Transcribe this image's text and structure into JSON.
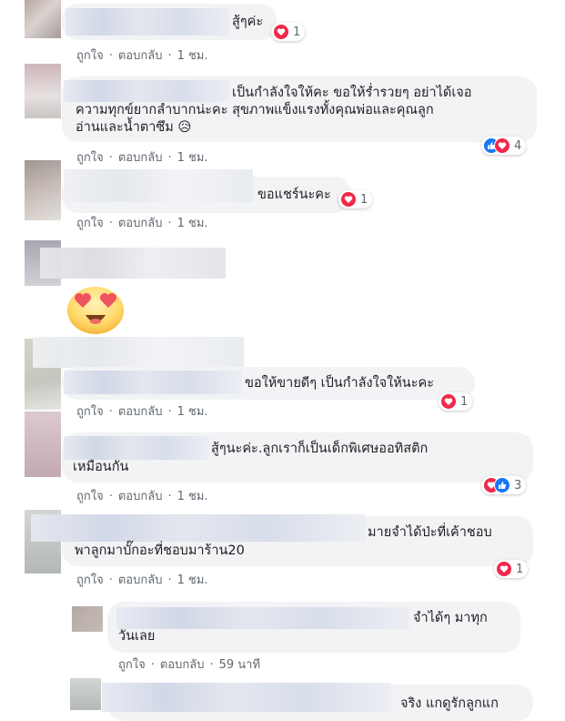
{
  "labels": {
    "like": "ถูกใจ",
    "reply": "ตอบกลับ",
    "dot": "·"
  },
  "colors": {
    "bubble": "#f2f3f5",
    "meta_text": "#606770",
    "love": "#f0284a",
    "like": "#1877f2"
  },
  "comments": [
    {
      "lines": [
        "สู้ๆค่ะ"
      ],
      "time": "1 ชม.",
      "reactions": {
        "icons": [
          "love-icon"
        ],
        "count": "1"
      }
    },
    {
      "lines": [
        "เป็นกำลังใจให้คะ ขอให้ร่ำรวยๆ อย่าได้เจอ",
        "ความทุกข์ยากลำบากน่ะคะ สุขภาพแข็งแรงทั้งคุณพ่อและคุณลูก",
        "อ่านและน้ำตาซึม 😥"
      ],
      "time": "1 ชม.",
      "reactions": {
        "icons": [
          "like-icon",
          "love-icon"
        ],
        "count": "4"
      }
    },
    {
      "lines": [
        "ขอแชร์นะคะ"
      ],
      "time": "1 ชม.",
      "reactions": {
        "icons": [
          "love-icon"
        ],
        "count": "1"
      }
    },
    {
      "sticker": "heart-eyes-emoji"
    },
    {
      "lines": [
        "ขอให้ขายดีๆ เป็นกำลังใจให้นะคะ"
      ],
      "time": "1 ชม.",
      "reactions": {
        "icons": [
          "love-icon"
        ],
        "count": "1"
      }
    },
    {
      "lines": [
        "สู้ๆนะค่ะ.ลูกเราก็เป็นเด็กพิเศษออทิสติก",
        "เหมือนกัน"
      ],
      "time": "1 ชม.",
      "reactions": {
        "icons": [
          "love-icon",
          "like-icon"
        ],
        "count": "3"
      }
    },
    {
      "lines": [
        "มายจำได้ป่ะที่เค้าชอบ",
        "พาลูกมาบั๊กอะที่ชอบมาร้าน20"
      ],
      "time": "1 ชม.",
      "reactions": {
        "icons": [
          "love-icon"
        ],
        "count": "1"
      }
    }
  ],
  "replies": [
    {
      "lines": [
        "จำได้ๆ มาทุก",
        "วันเลย"
      ],
      "time": "59 นาที"
    },
    {
      "lines": [
        "จริง แกดูรักลูกแก"
      ]
    }
  ]
}
